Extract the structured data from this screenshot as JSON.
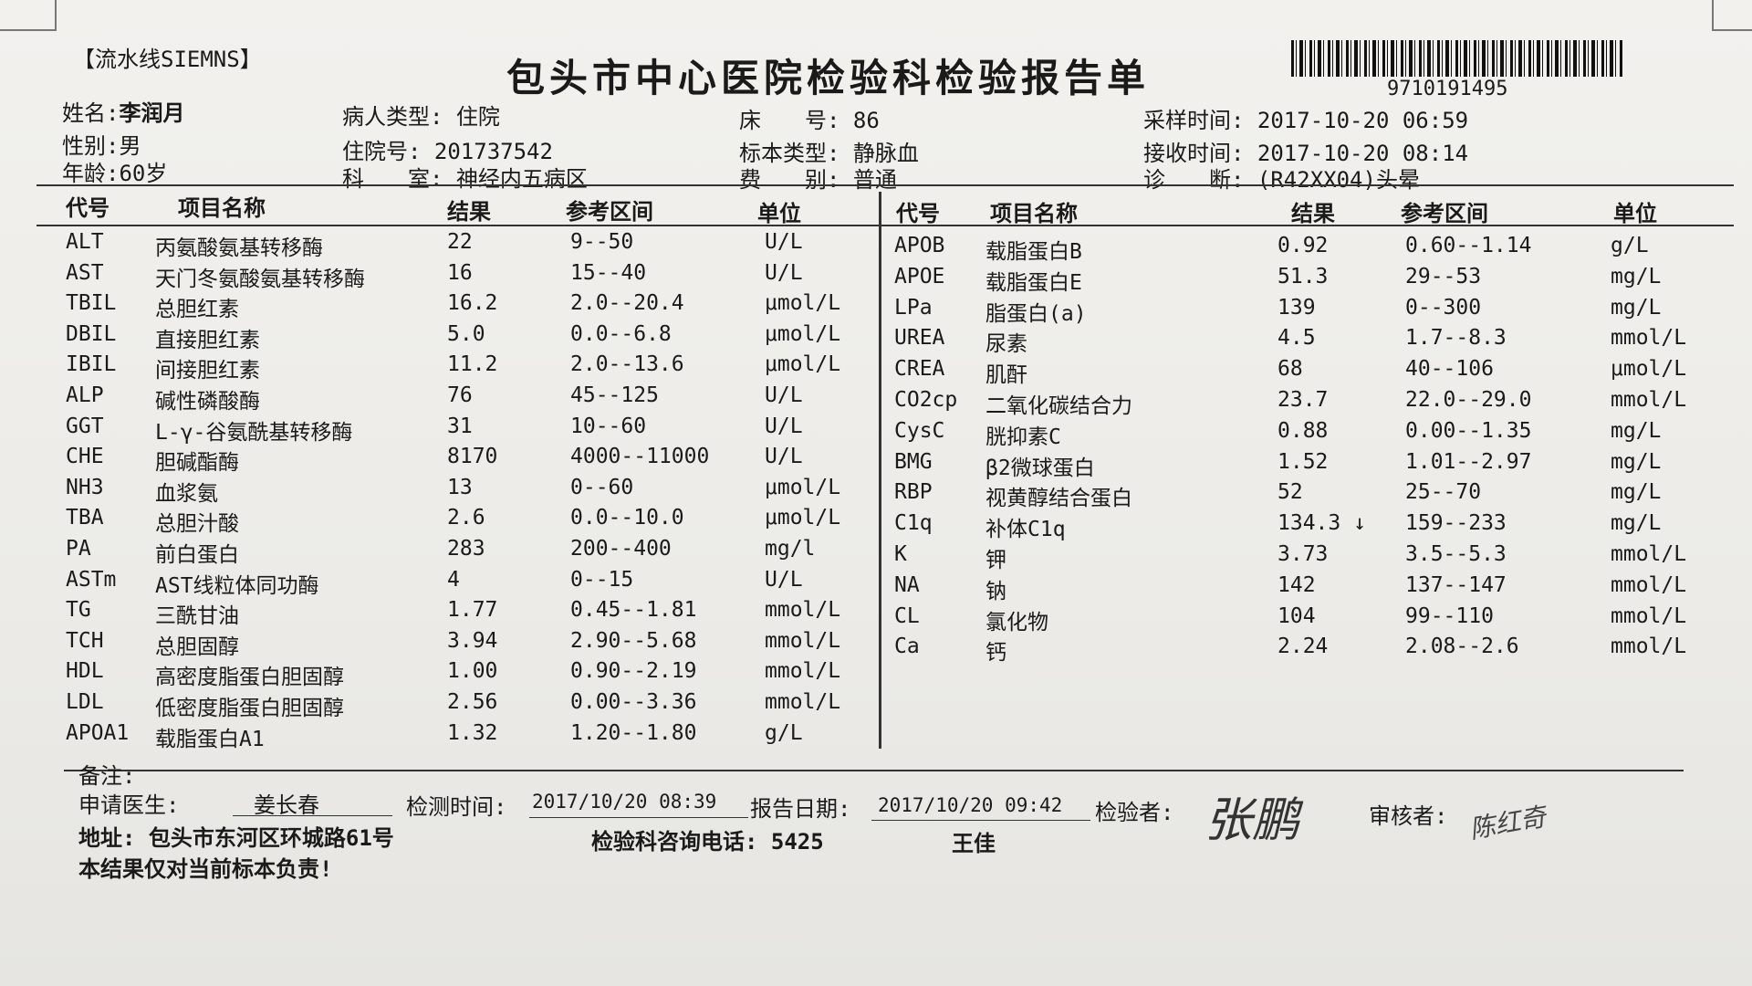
{
  "report": {
    "line_tag": "【流水线SIEMNS】",
    "title": "包头市中心医院检验科检验报告单",
    "barcode_number": "9710191495"
  },
  "patient": {
    "name_label": "姓名:",
    "name": "李润月",
    "sex_label": "性别:",
    "sex": "男",
    "age_label": "年龄:",
    "age": "60岁",
    "type_label": "病人类型:",
    "type": "住院",
    "admission_label": "住院号:",
    "admission": "201737542",
    "dept_label": "科　　室:",
    "dept": "神经内五病区",
    "bed_label": "床　　号:",
    "bed": "86",
    "specimen_label": "标本类型:",
    "specimen": "静脉血",
    "fee_label": "费　　别:",
    "fee": "普通",
    "sample_time_label": "采样时间:",
    "sample_time": "2017-10-20 06:59",
    "receive_time_label": "接收时间:",
    "receive_time": "2017-10-20 08:14",
    "diagnosis_label": "诊　　断:",
    "diagnosis": "(R42XX04)头晕"
  },
  "columns": {
    "code": "代号",
    "name": "项目名称",
    "result": "结果",
    "range": "参考区间",
    "unit": "单位"
  },
  "left_rows": [
    {
      "code": "ALT",
      "name": "丙氨酸氨基转移酶",
      "result": "22",
      "range": "9--50",
      "unit": "U/L"
    },
    {
      "code": "AST",
      "name": "天门冬氨酸氨基转移酶",
      "result": "16",
      "range": "15--40",
      "unit": "U/L"
    },
    {
      "code": "TBIL",
      "name": "总胆红素",
      "result": "16.2",
      "range": "2.0--20.4",
      "unit": "μmol/L"
    },
    {
      "code": "DBIL",
      "name": "直接胆红素",
      "result": "5.0",
      "range": "0.0--6.8",
      "unit": "μmol/L"
    },
    {
      "code": "IBIL",
      "name": "间接胆红素",
      "result": "11.2",
      "range": "2.0--13.6",
      "unit": "μmol/L"
    },
    {
      "code": "ALP",
      "name": "碱性磷酸酶",
      "result": "76",
      "range": "45--125",
      "unit": "U/L"
    },
    {
      "code": "GGT",
      "name": "L-γ-谷氨酰基转移酶",
      "result": "31",
      "range": "10--60",
      "unit": "U/L"
    },
    {
      "code": "CHE",
      "name": "胆碱酯酶",
      "result": "8170",
      "range": "4000--11000",
      "unit": "U/L"
    },
    {
      "code": "NH3",
      "name": "血浆氨",
      "result": "13",
      "range": "0--60",
      "unit": "μmol/L"
    },
    {
      "code": "TBA",
      "name": "总胆汁酸",
      "result": "2.6",
      "range": "0.0--10.0",
      "unit": "μmol/L"
    },
    {
      "code": "PA",
      "name": "前白蛋白",
      "result": "283",
      "range": "200--400",
      "unit": "mg/l"
    },
    {
      "code": "ASTm",
      "name": "AST线粒体同功酶",
      "result": "4",
      "range": "0--15",
      "unit": "U/L"
    },
    {
      "code": "TG",
      "name": "三酰甘油",
      "result": "1.77",
      "range": "0.45--1.81",
      "unit": "mmol/L"
    },
    {
      "code": "TCH",
      "name": "总胆固醇",
      "result": "3.94",
      "range": "2.90--5.68",
      "unit": "mmol/L"
    },
    {
      "code": "HDL",
      "name": "高密度脂蛋白胆固醇",
      "result": "1.00",
      "range": "0.90--2.19",
      "unit": "mmol/L"
    },
    {
      "code": "LDL",
      "name": "低密度脂蛋白胆固醇",
      "result": "2.56",
      "range": "0.00--3.36",
      "unit": "mmol/L"
    },
    {
      "code": "APOA1",
      "name": "载脂蛋白A1",
      "result": "1.32",
      "range": "1.20--1.80",
      "unit": "g/L"
    }
  ],
  "right_rows": [
    {
      "code": "APOB",
      "name": "载脂蛋白B",
      "result": "0.92",
      "range": "0.60--1.14",
      "unit": "g/L"
    },
    {
      "code": "APOE",
      "name": "载脂蛋白E",
      "result": "51.3",
      "range": "29--53",
      "unit": "mg/L"
    },
    {
      "code": "LPa",
      "name": "脂蛋白(a)",
      "result": "139",
      "range": "0--300",
      "unit": "mg/L"
    },
    {
      "code": "UREA",
      "name": "尿素",
      "result": "4.5",
      "range": "1.7--8.3",
      "unit": "mmol/L"
    },
    {
      "code": "CREA",
      "name": "肌酐",
      "result": "68",
      "range": "40--106",
      "unit": "μmol/L"
    },
    {
      "code": "CO2cp",
      "name": "二氧化碳结合力",
      "result": "23.7",
      "range": "22.0--29.0",
      "unit": "mmol/L"
    },
    {
      "code": "CysC",
      "name": "胱抑素C",
      "result": "0.88",
      "range": "0.00--1.35",
      "unit": "mg/L"
    },
    {
      "code": "BMG",
      "name": "β2微球蛋白",
      "result": "1.52",
      "range": "1.01--2.97",
      "unit": "mg/L"
    },
    {
      "code": "RBP",
      "name": "视黄醇结合蛋白",
      "result": "52",
      "range": "25--70",
      "unit": "mg/L"
    },
    {
      "code": "C1q",
      "name": "补体C1q",
      "result": "134.3 ↓",
      "range": "159--233",
      "unit": "mg/L"
    },
    {
      "code": "K",
      "name": "钾",
      "result": "3.73",
      "range": "3.5--5.3",
      "unit": "mmol/L"
    },
    {
      "code": "NA",
      "name": "钠",
      "result": "142",
      "range": "137--147",
      "unit": "mmol/L"
    },
    {
      "code": "CL",
      "name": "氯化物",
      "result": "104",
      "range": "99--110",
      "unit": "mmol/L"
    },
    {
      "code": "Ca",
      "name": "钙",
      "result": "2.24",
      "range": "2.08--2.6",
      "unit": "mmol/L"
    }
  ],
  "footer": {
    "remark_label": "备注:",
    "doctor_label": "申请医生:",
    "doctor": "姜长春",
    "test_time_label": "检测时间:",
    "test_time": "2017/10/20 08:39",
    "report_date_label": "报告日期:",
    "report_date": "2017/10/20 09:42",
    "tester_label": "检验者:",
    "tester_signature": "张鹏",
    "reviewer_label": "审核者:",
    "reviewer_signature": "陈红奇",
    "address": "地址: 包头市东河区环城路61号",
    "phone": "检验科咨询电话: 5425",
    "contact": "王佳",
    "disclaimer": "本结果仅对当前标本负责!"
  }
}
